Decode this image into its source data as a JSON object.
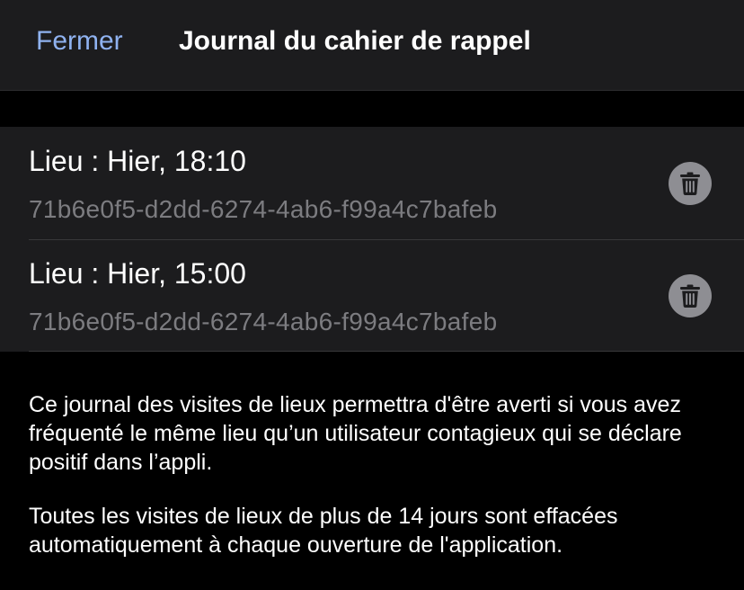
{
  "header": {
    "close_label": "Fermer",
    "title": "Journal du cahier de rappel"
  },
  "entries": [
    {
      "title": "Lieu : Hier, 18:10",
      "id": "71b6e0f5-d2dd-6274-4ab6-f99a4c7bafeb"
    },
    {
      "title": "Lieu : Hier, 15:00",
      "id": "71b6e0f5-d2dd-6274-4ab6-f99a4c7bafeb"
    }
  ],
  "footer": {
    "paragraph_1": "Ce journal des visites de lieux permettra d'être averti si vous avez fréquenté le même lieu qu’un utilisateur contagieux qui se déclare positif dans l’appli.",
    "paragraph_2": "Toutes les visites de lieux de plus de 14 jours sont effacées automatiquement à chaque ouverture de l'application."
  },
  "colors": {
    "accent": "#8fb2f0",
    "background": "#000000",
    "cell_background": "#1c1c1e",
    "secondary_text": "#7c7c80",
    "delete_button": "#8e8e93"
  },
  "icons": {
    "delete": "trash-icon"
  }
}
